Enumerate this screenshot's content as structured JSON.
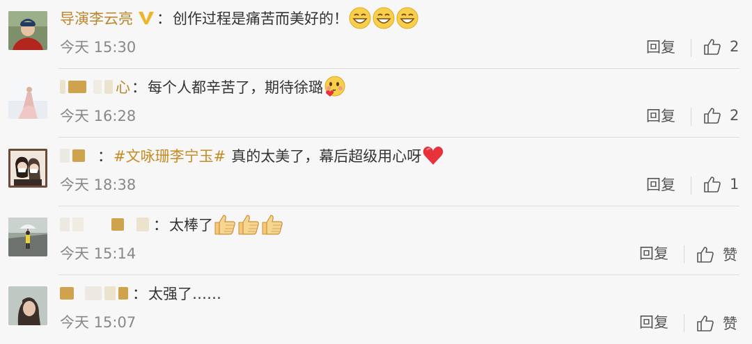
{
  "comments": [
    {
      "username": "导演李云亮",
      "verified": true,
      "colon": "：",
      "text": "创作过程是痛苦而美好的！",
      "time": "今天 15:30",
      "reply_label": "回复",
      "like_count": "2",
      "avatar_icon": "man-portrait-avatar",
      "emojis": [
        "grinning-face-emoji",
        "grinning-face-emoji",
        "grinning-face-emoji"
      ]
    },
    {
      "username_visible_tail": "心",
      "colon": "：",
      "text": "每个人都辛苦了，期待徐璐",
      "time": "今天 16:28",
      "reply_label": "回复",
      "like_count": "2",
      "avatar_icon": "woman-in-gown-avatar",
      "emojis": [
        "heart-holding-face-emoji"
      ]
    },
    {
      "colon": "：",
      "hashtag": "#文咏珊李宁玉#",
      "text": "真的太美了，幕后超级用心呀",
      "time": "今天 18:38",
      "reply_label": "回复",
      "like_count": "1",
      "avatar_icon": "two-people-selfie-avatar",
      "emojis": [
        "red-heart-emoji"
      ]
    },
    {
      "colon": "：",
      "text": "太棒了",
      "time": "今天 15:14",
      "reply_label": "回复",
      "like_label": "赞",
      "avatar_icon": "person-with-umbrella-avatar",
      "emojis": [
        "thumbs-up-emoji",
        "thumbs-up-emoji",
        "thumbs-up-emoji"
      ]
    },
    {
      "colon": "：",
      "text": "太强了……",
      "time": "今天 15:07",
      "reply_label": "回复",
      "like_label": "赞",
      "avatar_icon": "girl-portrait-avatar",
      "emojis": []
    }
  ],
  "colors": {
    "background": "#f7f7f7",
    "username": "#b9862c",
    "hashtag": "#c88a22",
    "meta_text": "#888888"
  }
}
